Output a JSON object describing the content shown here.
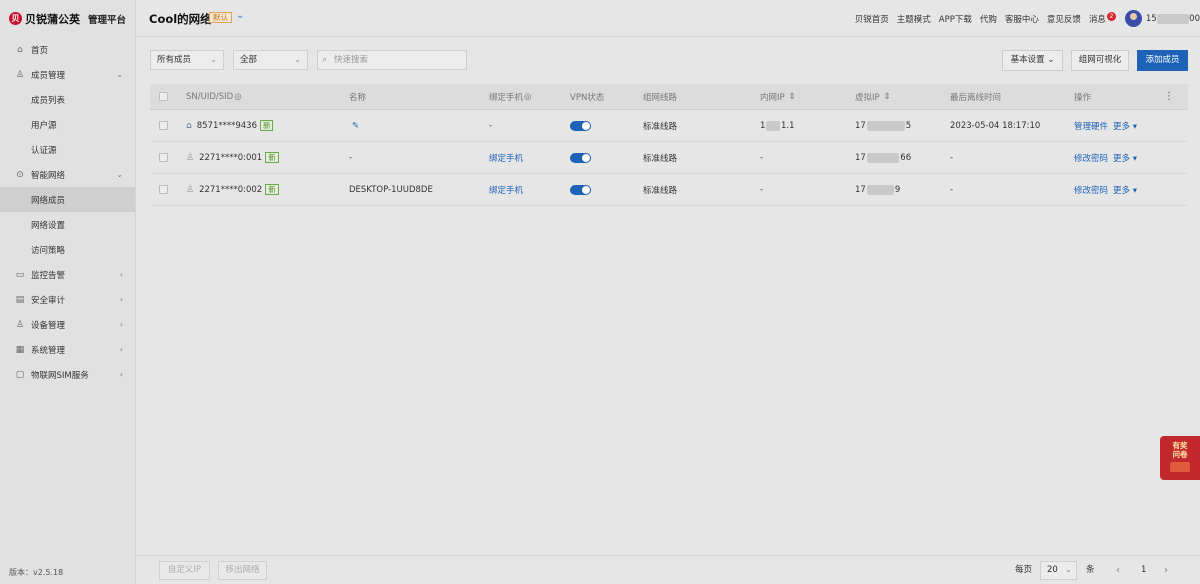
{
  "brand": {
    "logo": "贝",
    "name": "贝锐蒲公英",
    "subtitle": "管理平台"
  },
  "sidebar": {
    "items": [
      {
        "label": "首页",
        "icon": "home-icon",
        "glyph": "⌂"
      },
      {
        "label": "成员管理",
        "icon": "user-icon",
        "glyph": "♙",
        "arrow": "⌄"
      },
      {
        "label": "成员列表"
      },
      {
        "label": "用户源"
      },
      {
        "label": "认证源"
      },
      {
        "label": "智能网络",
        "icon": "network-icon",
        "glyph": "⊙",
        "arrow": "⌄"
      },
      {
        "label": "网络成员"
      },
      {
        "label": "网络设置"
      },
      {
        "label": "访问策略"
      },
      {
        "label": "监控告警",
        "icon": "monitor-icon",
        "glyph": "▭",
        "arrow": "›"
      },
      {
        "label": "安全审计",
        "icon": "audit-icon",
        "glyph": "▤",
        "arrow": "›"
      },
      {
        "label": "设备管理",
        "icon": "device-icon",
        "glyph": "♙",
        "arrow": "›"
      },
      {
        "label": "系统管理",
        "icon": "system-icon",
        "glyph": "▦",
        "arrow": "›"
      },
      {
        "label": "物联网SIM服务",
        "icon": "sim-icon",
        "glyph": "▢",
        "arrow": "›"
      }
    ],
    "version": "版本：v2.5.18"
  },
  "header": {
    "title": "Cool的网络",
    "default_badge": "默认",
    "chevron": "⌄",
    "links": [
      "贝锐首页",
      "主题模式",
      "APP下载",
      "代购",
      "客服中心",
      "意见反馈"
    ],
    "messages_label": "消息",
    "messages_count": "2",
    "user_prefix": "15",
    "user_suffix": "00"
  },
  "toolbar": {
    "member_filter": "所有成员",
    "type_filter": "全部",
    "search_placeholder": "快速搜索",
    "basic_settings": "基本设置",
    "visualize": "组网可视化",
    "add_member": "添加成员",
    "dropdown": "⌄",
    "search_glyph": "⌕"
  },
  "table": {
    "headers": {
      "sn": "SN/UID/SID",
      "name": "名称",
      "bind_phone": "绑定手机",
      "vpn": "VPN状态",
      "route": "组网线路",
      "lan_ip": "内网IP",
      "virtual_ip": "虚拟IP",
      "last_offline": "最后离线时间",
      "actions": "操作",
      "sort_glyph": "⇕",
      "eye_glyph": "◎",
      "menu_glyph": "⋮"
    },
    "rows": [
      {
        "id": "8571****9436",
        "tag": "新",
        "name_glyph": "✎",
        "name": "",
        "phone": "-",
        "route": "标准线路",
        "lan_a": "1",
        "lan_b": "1.1",
        "vip_a": "17",
        "vip_b": "5",
        "offline": "2023-05-04 18:17:10",
        "action1": "管理硬件",
        "more": "更多 ▾",
        "type_glyph": "⌂"
      },
      {
        "id": "2271****0:001",
        "tag": "新",
        "name": "-",
        "phone": "绑定手机",
        "route": "标准线路",
        "lan": "-",
        "vip_a": "17",
        "vip_b": "66",
        "offline": "-",
        "action1": "修改密码",
        "more": "更多 ▾",
        "type_glyph": "♙"
      },
      {
        "id": "2271****0:002",
        "tag": "新",
        "name": "DESKTOP-1UUD8DE",
        "phone": "绑定手机",
        "route": "标准线路",
        "lan": "-",
        "vip_a": "17",
        "vip_b": "9",
        "offline": "-",
        "action1": "修改密码",
        "more": "更多 ▾",
        "type_glyph": "♙"
      }
    ]
  },
  "footer": {
    "custom_ip": "自定义IP",
    "exit_network": "移出网络",
    "per_page_label": "每页",
    "per_page": "20",
    "unit": "条",
    "prev": "‹",
    "page": "1",
    "next": "›"
  },
  "promo": {
    "line1": "有奖",
    "line2": "问卷"
  },
  "colors": {
    "primary": "#1e63b8",
    "brand": "#c8102e",
    "badge": "#d8262c",
    "new_tag": "#4f8a2c"
  }
}
